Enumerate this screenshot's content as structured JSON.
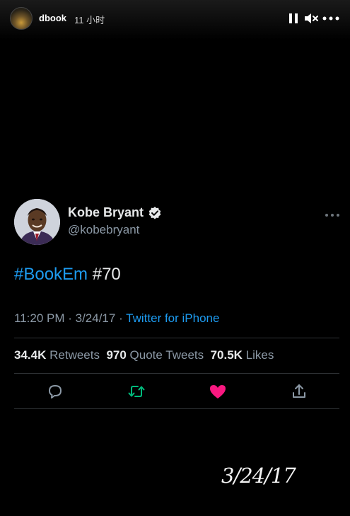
{
  "story": {
    "username": "dbook",
    "time_ago": "11 小时",
    "icons": [
      "pause-icon",
      "mute-icon",
      "more-icon"
    ]
  },
  "tweet": {
    "display_name": "Kobe Bryant",
    "handle": "@kobebryant",
    "hashtag": "#BookEm",
    "text_rest": " #70",
    "time": "11:20 PM",
    "date": "3/24/17",
    "source": "Twitter for iPhone",
    "separator": " · ",
    "retweets_count": "34.4K",
    "retweets_label": "Retweets",
    "quote_count": "970",
    "quote_label": "Quote Tweets",
    "likes_count": "70.5K",
    "likes_label": "Likes",
    "actions": [
      "reply-icon",
      "retweet-icon",
      "like-icon",
      "share-icon"
    ]
  },
  "overlay": {
    "date_text": "3/24/17"
  },
  "colors": {
    "background": "#000000",
    "link_blue": "#1d9bf0",
    "secondary_text": "#8b98a5",
    "retweet_green": "#00ba7c",
    "like_pink": "#f91880"
  }
}
